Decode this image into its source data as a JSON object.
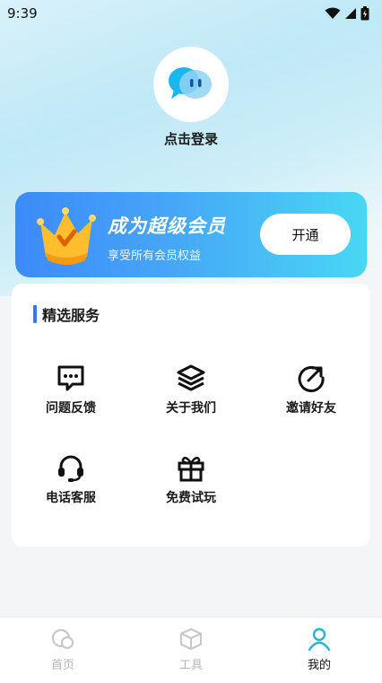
{
  "status_bar": {
    "time": "9:39",
    "icons": [
      "wifi-icon",
      "signal-icon",
      "battery-icon"
    ]
  },
  "profile": {
    "avatar_icon": "chat-bubble-avatar-icon",
    "login_label": "点击登录"
  },
  "vip": {
    "title": "成为超级会员",
    "subtitle": "享受所有会员权益",
    "button_label": "开通",
    "icon": "crown-icon"
  },
  "services": {
    "title": "精选服务",
    "items": [
      {
        "label": "问题反馈",
        "icon": "message-dots-icon"
      },
      {
        "label": "关于我们",
        "icon": "layers-icon"
      },
      {
        "label": "邀请好友",
        "icon": "share-arrow-icon"
      },
      {
        "label": "电话客服",
        "icon": "headset-icon"
      },
      {
        "label": "免费试玩",
        "icon": "gift-icon"
      }
    ]
  },
  "tabbar": {
    "items": [
      {
        "label": "首页",
        "icon": "home-icon",
        "active": false
      },
      {
        "label": "工具",
        "icon": "box-icon",
        "active": false
      },
      {
        "label": "我的",
        "icon": "person-icon",
        "active": true
      }
    ]
  },
  "colors": {
    "accent": "#2f7bf5",
    "vip_start": "#3c8af8",
    "vip_end": "#48d7f3",
    "active_tab_icon": "#27b4d8"
  }
}
